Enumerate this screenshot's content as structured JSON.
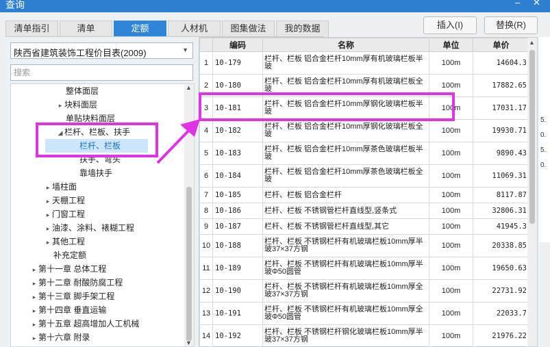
{
  "window": {
    "title": "查询",
    "minimize": "–",
    "close": "✕"
  },
  "tabs": [
    {
      "label": "清单指引",
      "active": false
    },
    {
      "label": "清单",
      "active": false
    },
    {
      "label": "定额",
      "active": true
    },
    {
      "label": "人材机",
      "active": false
    },
    {
      "label": "图集做法",
      "active": false
    },
    {
      "label": "我的数据",
      "active": false
    }
  ],
  "actions": {
    "insert": "插入(I)",
    "replace": "替换(R)"
  },
  "left": {
    "catalog": "陕西省建筑装饰工程价目表(2009)",
    "search_placeholder": "搜索",
    "tree": [
      {
        "label": "整体面层",
        "toggle": "",
        "level": 4
      },
      {
        "label": "块料面层",
        "toggle": "▸",
        "level": 3
      },
      {
        "label": "单贴块料面层",
        "toggle": "",
        "level": 4
      },
      {
        "label": "栏杆、栏板、扶手",
        "toggle": "◢",
        "level": 3
      },
      {
        "label": "栏杆、栏板",
        "toggle": "",
        "level": 4,
        "selected": true
      },
      {
        "label": "扶手、弯头",
        "toggle": "",
        "level": 4
      },
      {
        "label": "靠墙扶手",
        "toggle": "",
        "level": 4
      },
      {
        "label": "墙柱面",
        "toggle": "▸",
        "level": 2
      },
      {
        "label": "天棚工程",
        "toggle": "▸",
        "level": 2
      },
      {
        "label": "门窗工程",
        "toggle": "▸",
        "level": 2
      },
      {
        "label": "油漆、涂料、裱糊工程",
        "toggle": "▸",
        "level": 2
      },
      {
        "label": "其他工程",
        "toggle": "▸",
        "level": 2
      },
      {
        "label": "补充定额",
        "toggle": "",
        "level": 2
      },
      {
        "label": "第十一章 总体工程",
        "toggle": "▸",
        "level": 1
      },
      {
        "label": "第十二章 耐酸防腐工程",
        "toggle": "▸",
        "level": 1
      },
      {
        "label": "第十三章 脚手架工程",
        "toggle": "▸",
        "level": 1
      },
      {
        "label": "第十四章 垂直运输",
        "toggle": "▸",
        "level": 1
      },
      {
        "label": "第十五章 超高增加人工机械",
        "toggle": "▸",
        "level": 1
      },
      {
        "label": "第十六章 附录",
        "toggle": "▸",
        "level": 1
      }
    ]
  },
  "table": {
    "columns": [
      "",
      "编码",
      "名称",
      "单位",
      "单价"
    ],
    "rows": [
      {
        "n": "1",
        "code": "10-179",
        "name": "栏杆、栏板 铝合金栏杆10mm厚有机玻璃栏板半玻",
        "unit": "100m",
        "price": "14604.3"
      },
      {
        "n": "2",
        "code": "10-180",
        "name": "栏杆、栏板 铝合金栏杆10mm厚有机玻璃栏板全玻",
        "unit": "100m",
        "price": "17882.65"
      },
      {
        "n": "3",
        "code": "10-181",
        "name": "栏杆、栏板 铝合金栏杆10mm厚钢化玻璃栏板半玻",
        "unit": "100m",
        "price": "17031.17"
      },
      {
        "n": "4",
        "code": "10-182",
        "name": "栏杆、栏板 铝合金栏杆10mm厚钢化玻璃栏板全玻",
        "unit": "100m",
        "price": "19930.71"
      },
      {
        "n": "5",
        "code": "10-183",
        "name": "栏杆、栏板 铝合金栏杆10mm厚茶色玻璃栏板半玻",
        "unit": "100m",
        "price": "9890.43"
      },
      {
        "n": "6",
        "code": "10-184",
        "name": "栏杆、栏板 铝合金栏杆10mm厚茶色玻璃栏板全玻",
        "unit": "100m",
        "price": "11069.31"
      },
      {
        "n": "7",
        "code": "10-185",
        "name": "栏杆、栏板 铝合金栏杆",
        "unit": "100m",
        "price": "8117.87"
      },
      {
        "n": "8",
        "code": "10-186",
        "name": "栏杆、栏板 不锈钢管栏杆直线型,竖条式",
        "unit": "100m",
        "price": "32806.31"
      },
      {
        "n": "9",
        "code": "10-187",
        "name": "栏杆、栏板 不锈钢管栏杆直线型,其它",
        "unit": "100m",
        "price": "41945.3"
      },
      {
        "n": "10",
        "code": "10-188",
        "name": "栏杆、栏板 不锈钢栏杆有机玻璃栏板10mm厚半玻37×37方钢",
        "unit": "100m",
        "price": "20338.85"
      },
      {
        "n": "11",
        "code": "10-189",
        "name": "栏杆、栏板 不锈钢栏杆有机玻璃栏板10mm厚半玻Φ50圆管",
        "unit": "100m",
        "price": "19650.63"
      },
      {
        "n": "12",
        "code": "10-190",
        "name": "栏杆、栏板 不锈钢栏杆有机玻璃栏板10mm厚全玻37×37方钢",
        "unit": "100m",
        "price": "22731.92"
      },
      {
        "n": "13",
        "code": "10-191",
        "name": "栏杆、栏板 不锈钢栏杆有机玻璃栏板10mm厚全玻Φ50圆管",
        "unit": "100m",
        "price": "22033.7"
      },
      {
        "n": "14",
        "code": "10-192",
        "name": "栏杆、栏板 不锈钢栏杆钢化玻璃栏板10mm厚半玻37×37方钢",
        "unit": "100m",
        "price": "21976.22"
      }
    ]
  },
  "behind_text": [
    "5.",
    "0.",
    "5.",
    "0."
  ],
  "colors": {
    "accent": "#2f86d8",
    "annotation": "#e133e6",
    "selection": "#cce6fb"
  }
}
